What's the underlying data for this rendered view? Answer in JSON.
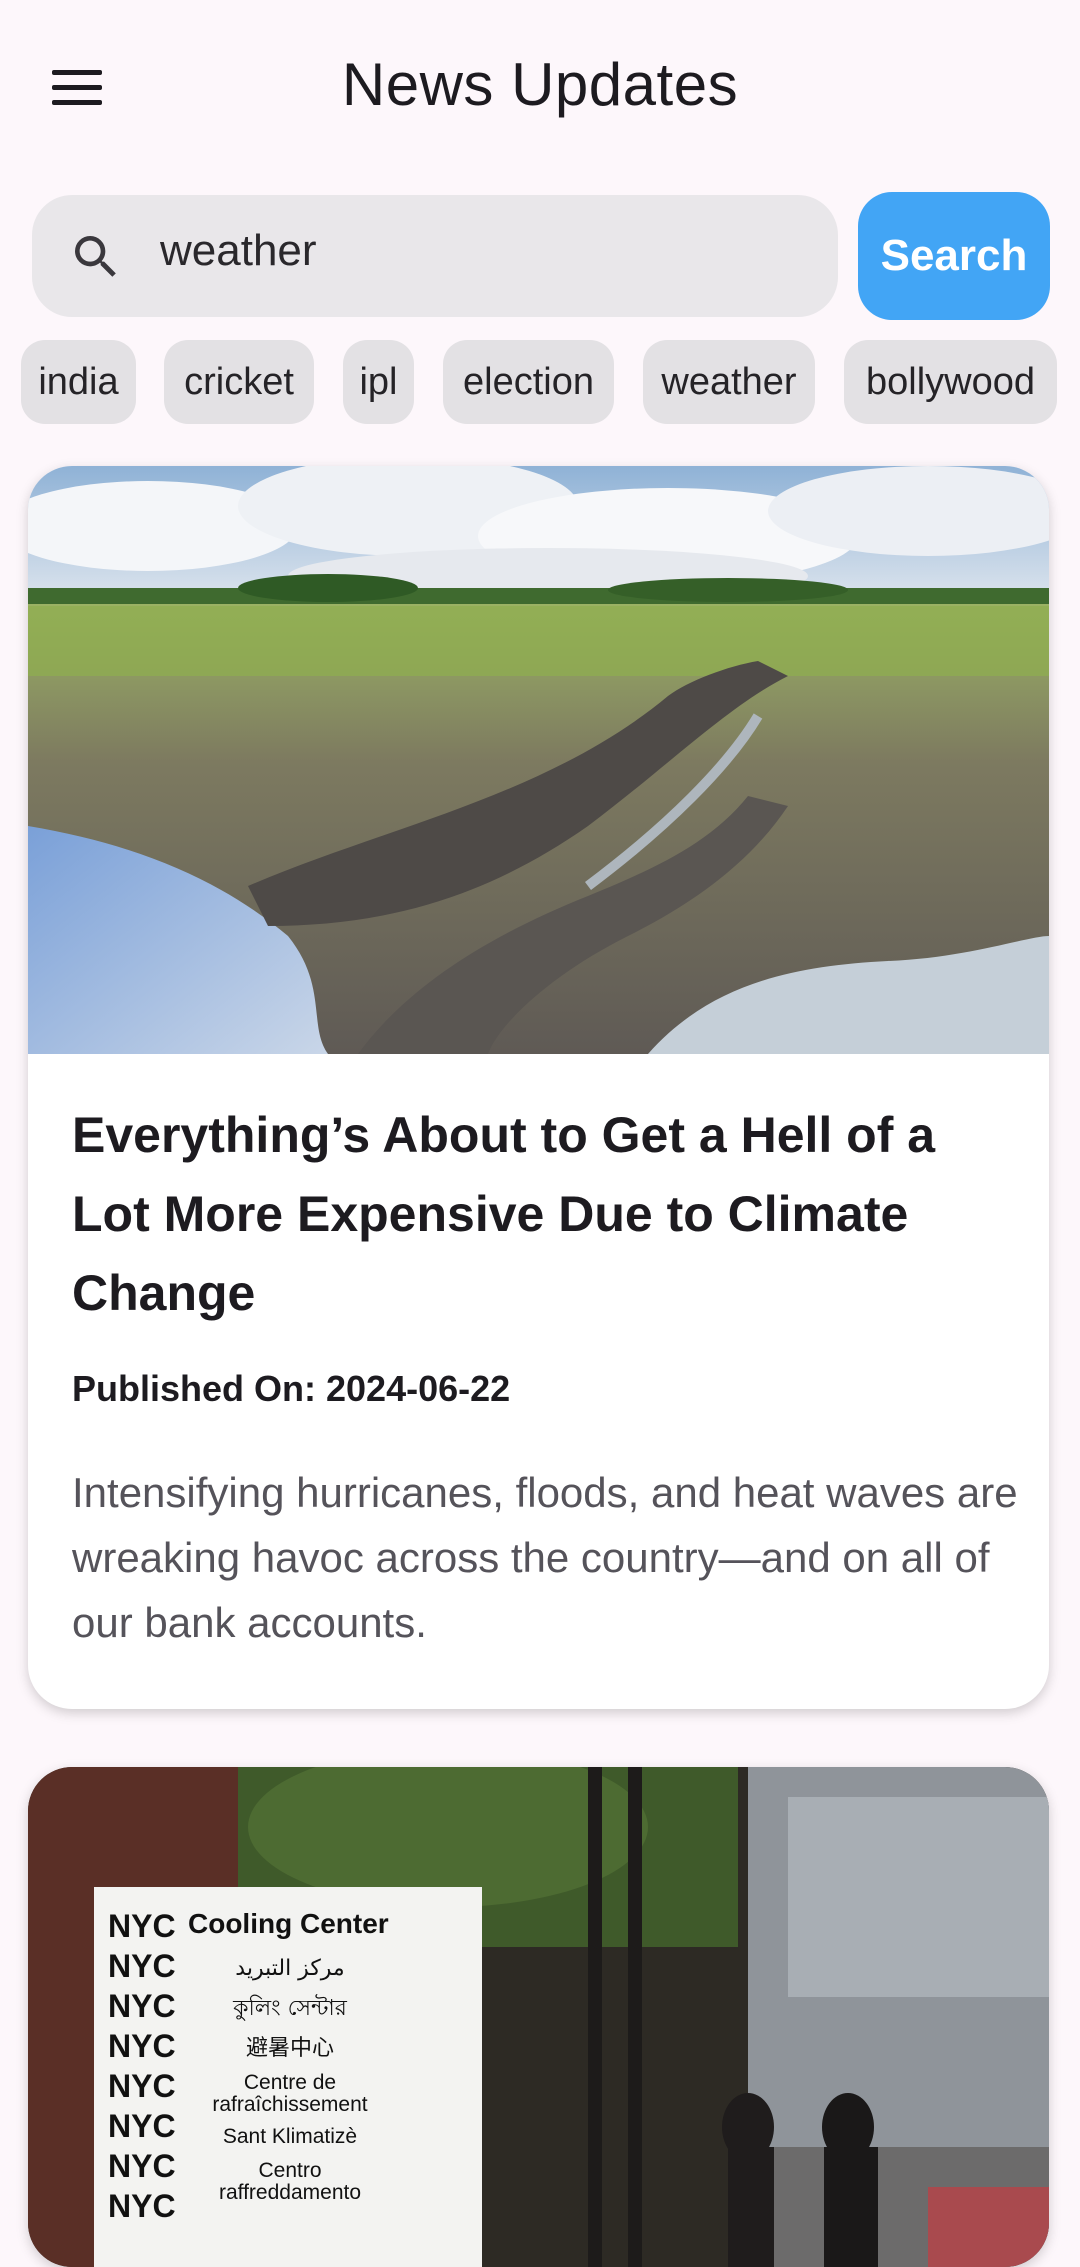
{
  "appbar": {
    "title": "News Updates",
    "menu_icon": "menu-icon"
  },
  "search": {
    "value": "weather",
    "button_label": "Search",
    "icon": "search-icon",
    "button_color": "#42a5f5"
  },
  "chips": [
    "india",
    "cricket",
    "ipl",
    "election",
    "weather",
    "bollywood"
  ],
  "articles": [
    {
      "title": "Everything’s About to Get a Hell of a Lot More Expensive Due to Climate Change",
      "published": "Published On: 2024-06-22",
      "description": "Intensifying hurricanes, floods, and heat waves are wreaking havoc across the country—and on all of our bank accounts."
    },
    {
      "sign": {
        "header": "Cooling Center",
        "brand": "NYC",
        "lines": [
          "مركز التبريد",
          "কুলিং সেন্টার",
          "避暑中心",
          "Centre de",
          "rafraîchissement",
          "Sant Klimatizè",
          "Centro",
          "raffreddamento"
        ]
      }
    }
  ]
}
